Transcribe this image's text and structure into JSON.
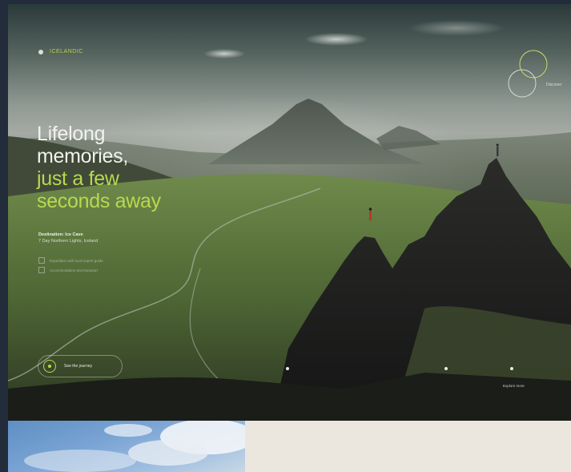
{
  "brand": {
    "logo_text": "ICELANDIC",
    "accent_color": "#b8d94e",
    "logo_icon": "dot-icon"
  },
  "rings": {
    "icon": "double-ring-icon",
    "label": "Discover"
  },
  "hero": {
    "headline_lines": [
      "Lifelong",
      "memories,",
      "just a few",
      "seconds away"
    ],
    "destination_title": "Destination: Ice Cave",
    "destination_subtitle": "7 Day Northern Lights, Iceland",
    "checks": [
      "Expedition with local expert guide",
      "Accommodation and transport"
    ],
    "cta_label": "See the journey",
    "cta_icon": "play-circle-icon",
    "next_label": "Explore more"
  },
  "lower": {
    "photo": "sky-clouds-photo",
    "panel_color": "#ebe7df"
  }
}
